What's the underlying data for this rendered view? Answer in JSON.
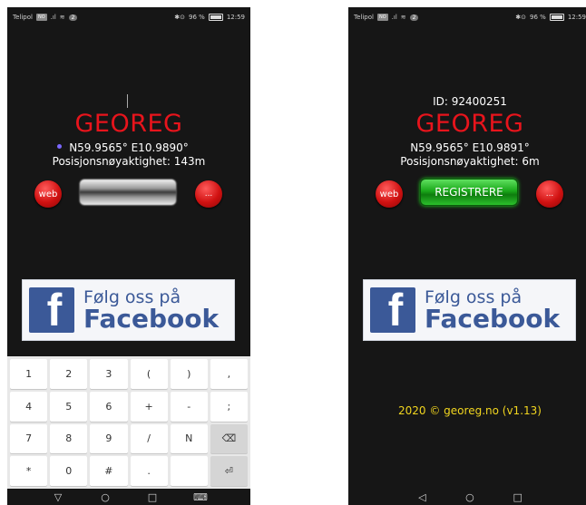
{
  "left_phone": {
    "status": {
      "carrier": "Telipol",
      "badge": "NO",
      "signal": ".ıl",
      "wifi": "≋",
      "notif": "2",
      "icons": "✱⊙",
      "battery_pct": "96 %",
      "time": "12:59"
    },
    "title": "GEOREG",
    "coords": "N59.9565° E10.9890°",
    "accuracy": "Posisjonsnøyaktighet: 143m",
    "web_label": "web",
    "more_label": "...",
    "facebook": {
      "line1": "Følg oss på",
      "line2": "Facebook",
      "logo": "f"
    },
    "keyboard": {
      "keys": [
        "1",
        "2",
        "3",
        "(",
        ")",
        ",",
        "4",
        "5",
        "6",
        "+",
        "-",
        ";",
        "7",
        "8",
        "9",
        "/",
        "N",
        "⌫",
        "*",
        "0",
        "#",
        ".",
        "",
        "⏎"
      ]
    },
    "nav": {
      "back": "▽",
      "home": "○",
      "recent": "□",
      "keyboard": "⌨"
    }
  },
  "right_phone": {
    "status": {
      "carrier": "Telipol",
      "badge": "NO",
      "signal": ".ıl",
      "wifi": "≋",
      "notif": "2",
      "icons": "✱⊙",
      "battery_pct": "96 %",
      "time": "12:59"
    },
    "id_label": "ID: 92400251",
    "title": "GEOREG",
    "coords": "N59.9565° E10.9891°",
    "accuracy": "Posisjonsnøyaktighet: 6m",
    "web_label": "web",
    "register_label": "REGISTRERE",
    "more_label": "...",
    "facebook": {
      "line1": "Følg oss på",
      "line2": "Facebook",
      "logo": "f"
    },
    "footer": "2020 © georeg.no (v1.13)",
    "nav": {
      "back": "◁",
      "home": "○",
      "recent": "□"
    }
  },
  "colors": {
    "title_red": "#e8141c",
    "footer_yellow": "#f1d51f",
    "facebook_blue": "#3b5998",
    "register_green": "#1aa81a"
  }
}
